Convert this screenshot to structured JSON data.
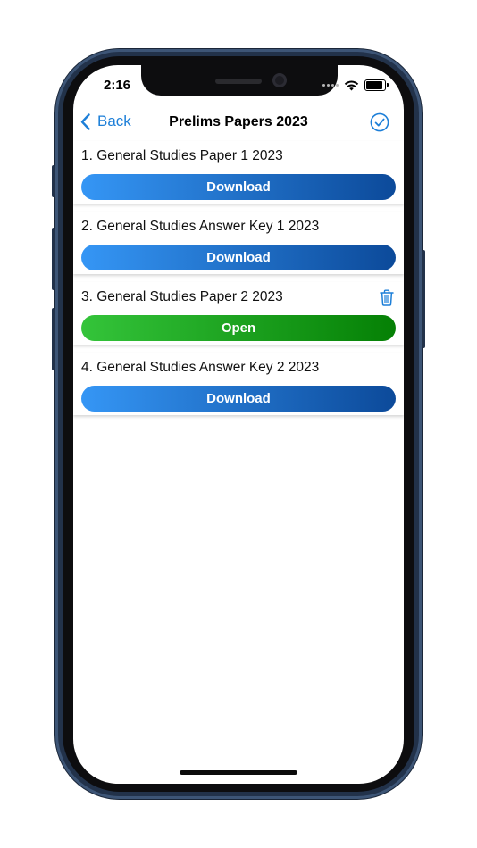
{
  "status_bar": {
    "time": "2:16"
  },
  "nav": {
    "back_label": "Back",
    "title": "Prelims Papers 2023"
  },
  "papers": [
    {
      "title": "1.  General Studies Paper 1 2023",
      "action_label": "Download",
      "state": "download",
      "has_delete": false
    },
    {
      "title": "2.  General Studies Answer Key 1 2023",
      "action_label": "Download",
      "state": "download",
      "has_delete": false
    },
    {
      "title": "3.  General Studies Paper 2 2023",
      "action_label": "Open",
      "state": "open",
      "has_delete": true
    },
    {
      "title": "4.  General Studies Answer Key 2 2023",
      "action_label": "Download",
      "state": "download",
      "has_delete": false
    }
  ],
  "icons": {
    "back": "chevron-left-icon",
    "done": "checkmark-circle-icon",
    "delete": "trash-icon"
  },
  "colors": {
    "accent": "#1d7fd8",
    "download_gradient_start": "#3596f5",
    "download_gradient_end": "#0c4a9a",
    "open_gradient_start": "#34c43a",
    "open_gradient_end": "#058005",
    "frame": "#22324a"
  }
}
